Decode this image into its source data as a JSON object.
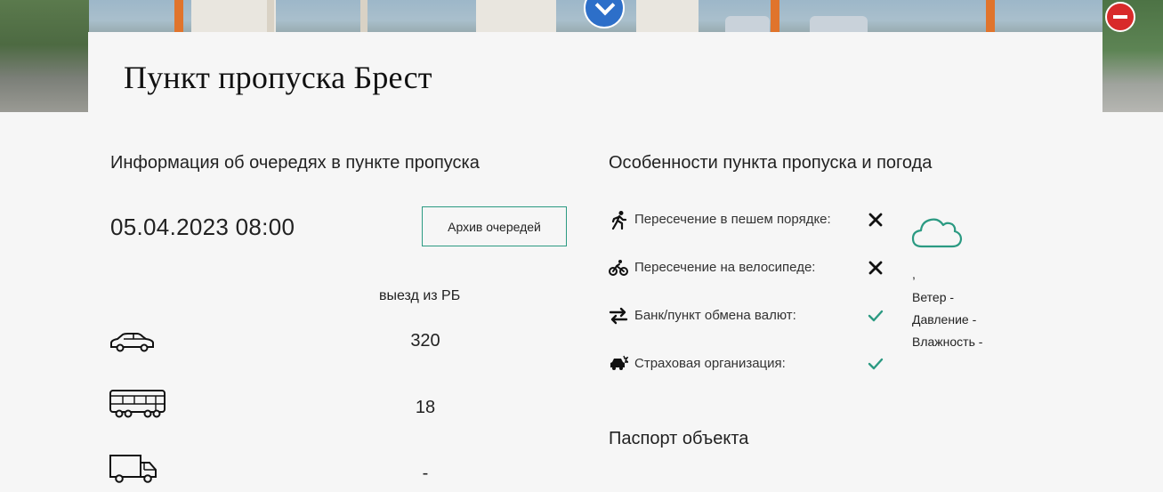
{
  "page": {
    "title": "Пункт пропуска Брест"
  },
  "queues": {
    "heading": "Информация об очередях в пункте пропуска",
    "datetime": "05.04.2023 08:00",
    "archive_button": "Архив очередей",
    "direction_label": "выезд из РБ",
    "rows": [
      {
        "icon": "car-icon",
        "value": "320"
      },
      {
        "icon": "bus-icon",
        "value": "18"
      },
      {
        "icon": "truck-icon",
        "value": "-"
      }
    ]
  },
  "features": {
    "heading": "Особенности пункта пропуска и погода",
    "items": [
      {
        "icon": "pedestrian-icon",
        "label": "Пересечение в пешем порядке:",
        "status": "no"
      },
      {
        "icon": "bicycle-icon",
        "label": "Пересечение на велосипеде:",
        "status": "no"
      },
      {
        "icon": "exchange-icon",
        "label": "Банк/пункт обмена валют:",
        "status": "yes"
      },
      {
        "icon": "insurance-icon",
        "label": "Страховая организация:",
        "status": "yes"
      }
    ]
  },
  "weather": {
    "icon": "cloud-icon",
    "summary": ",",
    "wind": "Ветер -",
    "pressure": "Давление -",
    "humidity": "Влажность -"
  },
  "passport": {
    "heading": "Паспорт объекта"
  },
  "colors": {
    "accent": "#2b9a82",
    "cross": "#111111",
    "background": "#f6f6f6"
  }
}
